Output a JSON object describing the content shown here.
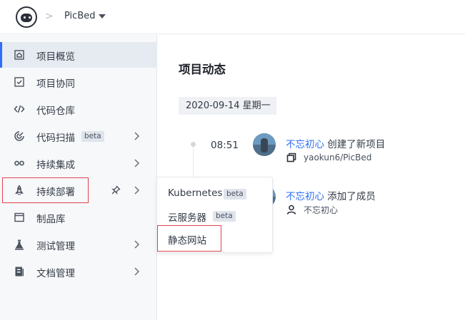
{
  "header": {
    "project_name": "PicBed",
    "separator": ">"
  },
  "sidebar": {
    "items": [
      {
        "label": "项目概览",
        "icon": "home-icon",
        "active": true
      },
      {
        "label": "项目协同",
        "icon": "checkbox-icon"
      },
      {
        "label": "代码仓库",
        "icon": "code-icon"
      },
      {
        "label": "代码扫描",
        "icon": "scan-icon",
        "badge": "beta",
        "has_submenu": true
      },
      {
        "label": "持续集成",
        "icon": "infinity-icon",
        "has_submenu": true
      },
      {
        "label": "持续部署",
        "icon": "rocket-icon",
        "has_submenu": true,
        "pinned": true,
        "highlighted": true
      },
      {
        "label": "制品库",
        "icon": "package-icon"
      },
      {
        "label": "测试管理",
        "icon": "flask-icon",
        "has_submenu": true
      },
      {
        "label": "文档管理",
        "icon": "document-icon",
        "has_submenu": true
      }
    ]
  },
  "submenu": {
    "items": [
      {
        "label": "Kubernetes",
        "badge": "beta"
      },
      {
        "label": "云服务器",
        "badge": "beta"
      },
      {
        "label": "静态网站",
        "highlighted": true
      }
    ]
  },
  "main": {
    "title": "项目动态",
    "date": "2020-09-14 星期一",
    "events": [
      {
        "time": "08:51",
        "user": "不忘初心",
        "action": "创建了新项目",
        "detail": "yaokun6/PicBed",
        "detail_icon": "repo-icon"
      },
      {
        "time": "",
        "user": "不忘初心",
        "action": "添加了成员",
        "detail": "不忘初心",
        "detail_icon": "user-icon"
      }
    ]
  },
  "colors": {
    "accent": "#2d6ef5",
    "highlight_border": "#e0444c",
    "sidebar_bg": "#f7f8fa",
    "active_bg": "#e6eaf1"
  }
}
